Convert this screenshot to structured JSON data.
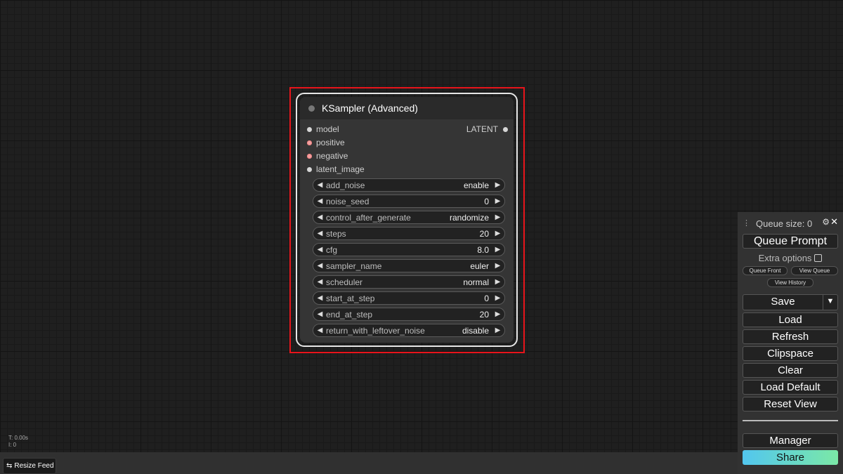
{
  "node": {
    "title": "KSampler (Advanced)",
    "inputs": [
      "model",
      "positive",
      "negative",
      "latent_image"
    ],
    "output": "LATENT",
    "widgets": [
      {
        "name": "add_noise",
        "value": "enable"
      },
      {
        "name": "noise_seed",
        "value": "0"
      },
      {
        "name": "control_after_generate",
        "value": "randomize"
      },
      {
        "name": "steps",
        "value": "20"
      },
      {
        "name": "cfg",
        "value": "8.0"
      },
      {
        "name": "sampler_name",
        "value": "euler"
      },
      {
        "name": "scheduler",
        "value": "normal"
      },
      {
        "name": "start_at_step",
        "value": "0"
      },
      {
        "name": "end_at_step",
        "value": "20"
      },
      {
        "name": "return_with_leftover_noise",
        "value": "disable"
      }
    ]
  },
  "panel": {
    "queue_size": "Queue size: 0",
    "queue_prompt": "Queue Prompt",
    "extra_options": "Extra options",
    "queue_front": "Queue Front",
    "view_queue": "View Queue",
    "view_history": "View History",
    "save": "Save",
    "load": "Load",
    "refresh": "Refresh",
    "clipspace": "Clipspace",
    "clear": "Clear",
    "load_default": "Load Default",
    "reset_view": "Reset View",
    "manager": "Manager",
    "share": "Share"
  },
  "stats": {
    "t": "T: 0.00s",
    "i": "I: 0"
  },
  "resize_feed": "Resize Feed"
}
